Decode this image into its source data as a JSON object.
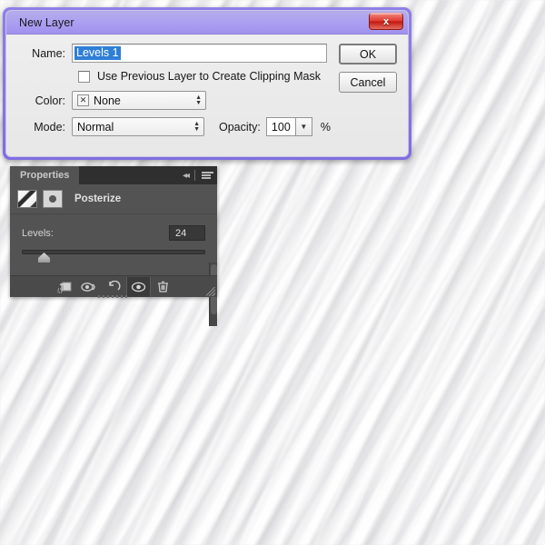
{
  "dialog": {
    "title": "New Layer",
    "close_label": "x",
    "name_label": "Name:",
    "name_value": "Levels 1",
    "checkbox_label": "Use Previous Layer to Create Clipping Mask",
    "checkbox_checked": false,
    "color_label": "Color:",
    "color_value": "None",
    "color_swatch_icon": "x-icon",
    "mode_label": "Mode:",
    "mode_value": "Normal",
    "opacity_label": "Opacity:",
    "opacity_value": "100",
    "percent_symbol": "%",
    "ok_label": "OK",
    "cancel_label": "Cancel",
    "titlebar_color": "#ab9ff2",
    "border_color": "#8f7fe8",
    "close_color": "#e0392f",
    "selection_color": "#2f7fd6"
  },
  "properties_panel": {
    "tab_label": "Properties",
    "collapse_icon": "double-chevron-left-icon",
    "menu_icon": "panel-menu-icon",
    "adjustment_title": "Posterize",
    "adjustment_thumb_icon": "adjustment-layer-thumbnail",
    "mask_thumb_icon": "layer-mask-thumbnail",
    "levels_label": "Levels:",
    "levels_value": "24",
    "footer_icons": [
      {
        "name": "clip-to-layer-icon",
        "active": false
      },
      {
        "name": "view-previous-state-icon",
        "active": false
      },
      {
        "name": "reset-adjustment-icon",
        "active": false
      },
      {
        "name": "toggle-layer-visibility-icon",
        "active": true
      },
      {
        "name": "delete-adjustment-layer-icon",
        "active": false
      }
    ]
  }
}
